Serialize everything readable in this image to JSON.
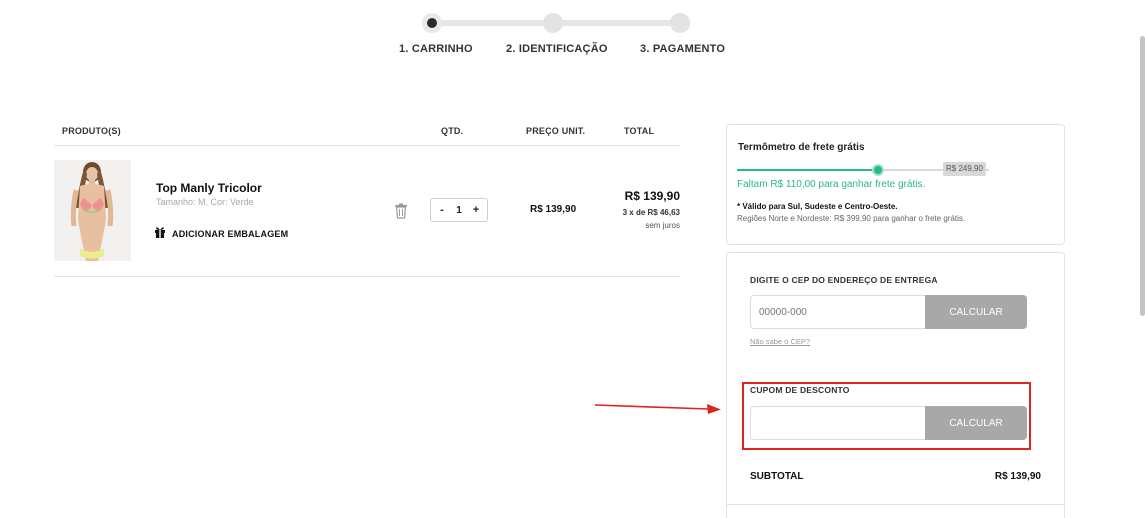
{
  "stepper": {
    "steps": [
      {
        "label": "1. CARRINHO",
        "active": true
      },
      {
        "label": "2. IDENTIFICAÇÃO",
        "active": false
      },
      {
        "label": "3. PAGAMENTO",
        "active": false
      }
    ]
  },
  "cart": {
    "headers": {
      "product": "PRODUTO(S)",
      "qty": "QTD.",
      "unit_price": "PREÇO UNIT.",
      "total": "TOTAL"
    },
    "items": [
      {
        "name": "Top Manly Tricolor",
        "variant": "Tamanho: M, Cor: Verde",
        "gift_label": "ADICIONAR EMBALAGEM",
        "quantity": "1",
        "qty_minus": "-",
        "qty_plus": "+",
        "unit_price": "R$ 139,90",
        "total_price": "R$ 139,90",
        "installments_prefix": "3 x de",
        "installments_value": "R$ 46,63",
        "interest": "sem juros"
      }
    ]
  },
  "free_shipping": {
    "title": "Termômetro de frete grátis",
    "progress": 0.56,
    "goal_value": "R$ 249,90",
    "remaining_message": "Faltam R$ 110,00 para ganhar frete grátis.",
    "note": "* Válido para Sul, Sudeste e Centro-Oeste.",
    "regions_note": "Regiões Norte e Nordeste: R$ 399,90 para ganhar o frete grátis.",
    "accent_color": "#27b88a"
  },
  "shipping": {
    "label": "DIGITE O CEP DO ENDEREÇO DE ENTREGA",
    "placeholder": "00000-000",
    "button_label": "CALCULAR",
    "help_link": "Não sabe o CEP?"
  },
  "coupon": {
    "label": "CUPOM DE DESCONTO",
    "placeholder": "",
    "button_label": "CALCULAR",
    "highlight_color": "#e02222"
  },
  "summary": {
    "subtotal_label": "SUBTOTAL",
    "subtotal_value": "R$ 139,90"
  }
}
